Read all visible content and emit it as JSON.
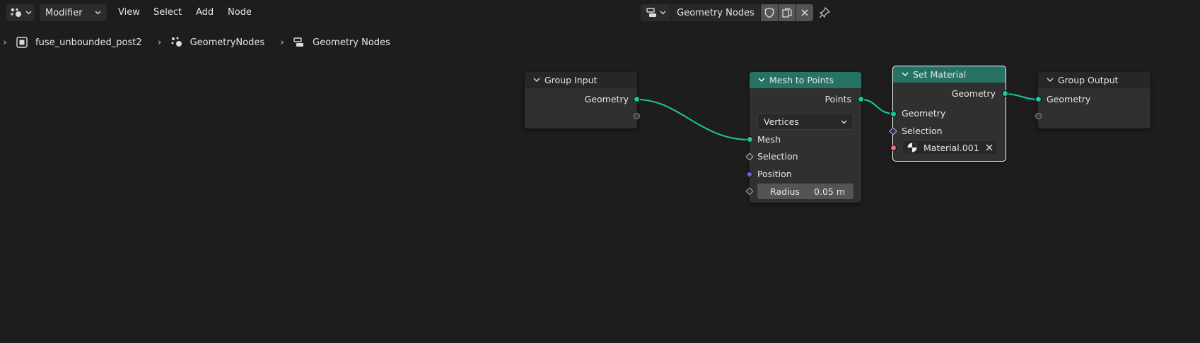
{
  "header": {
    "editor_type_icon": "geometry-nodes-editor-icon",
    "mode": "Modifier",
    "menus": [
      "View",
      "Select",
      "Add",
      "Node"
    ],
    "node_tree_name": "Geometry Nodes",
    "icons": [
      "shield-fake-user-icon",
      "duplicate-icon",
      "close-icon",
      "pin-icon"
    ]
  },
  "breadcrumb": {
    "items": [
      {
        "icon": "object-icon",
        "label": "fuse_unbounded_post2"
      },
      {
        "icon": "geometry-nodes-modifier-icon",
        "label": "GeometryNodes"
      },
      {
        "icon": "node-tree-icon",
        "label": "Geometry Nodes"
      }
    ]
  },
  "nodes": {
    "group_input": {
      "title": "Group Input",
      "outputs": [
        "Geometry"
      ]
    },
    "mesh_to_points": {
      "title": "Mesh to Points",
      "output": "Points",
      "mode": "Vertices",
      "inputs": [
        "Mesh",
        "Selection",
        "Position"
      ],
      "radius_label": "Radius",
      "radius_value": "0.05 m"
    },
    "set_material": {
      "title": "Set Material",
      "output": "Geometry",
      "inputs": [
        "Geometry",
        "Selection"
      ],
      "material": "Material.001"
    },
    "group_output": {
      "title": "Group Output",
      "inputs": [
        "Geometry"
      ]
    }
  },
  "colors": {
    "background": "#1d1d1d",
    "node_body": "#303030",
    "geometry_socket": "#19c8a0",
    "material_socket": "#ec7178",
    "geometry_header": "#267263",
    "link": "#19c8a0"
  }
}
